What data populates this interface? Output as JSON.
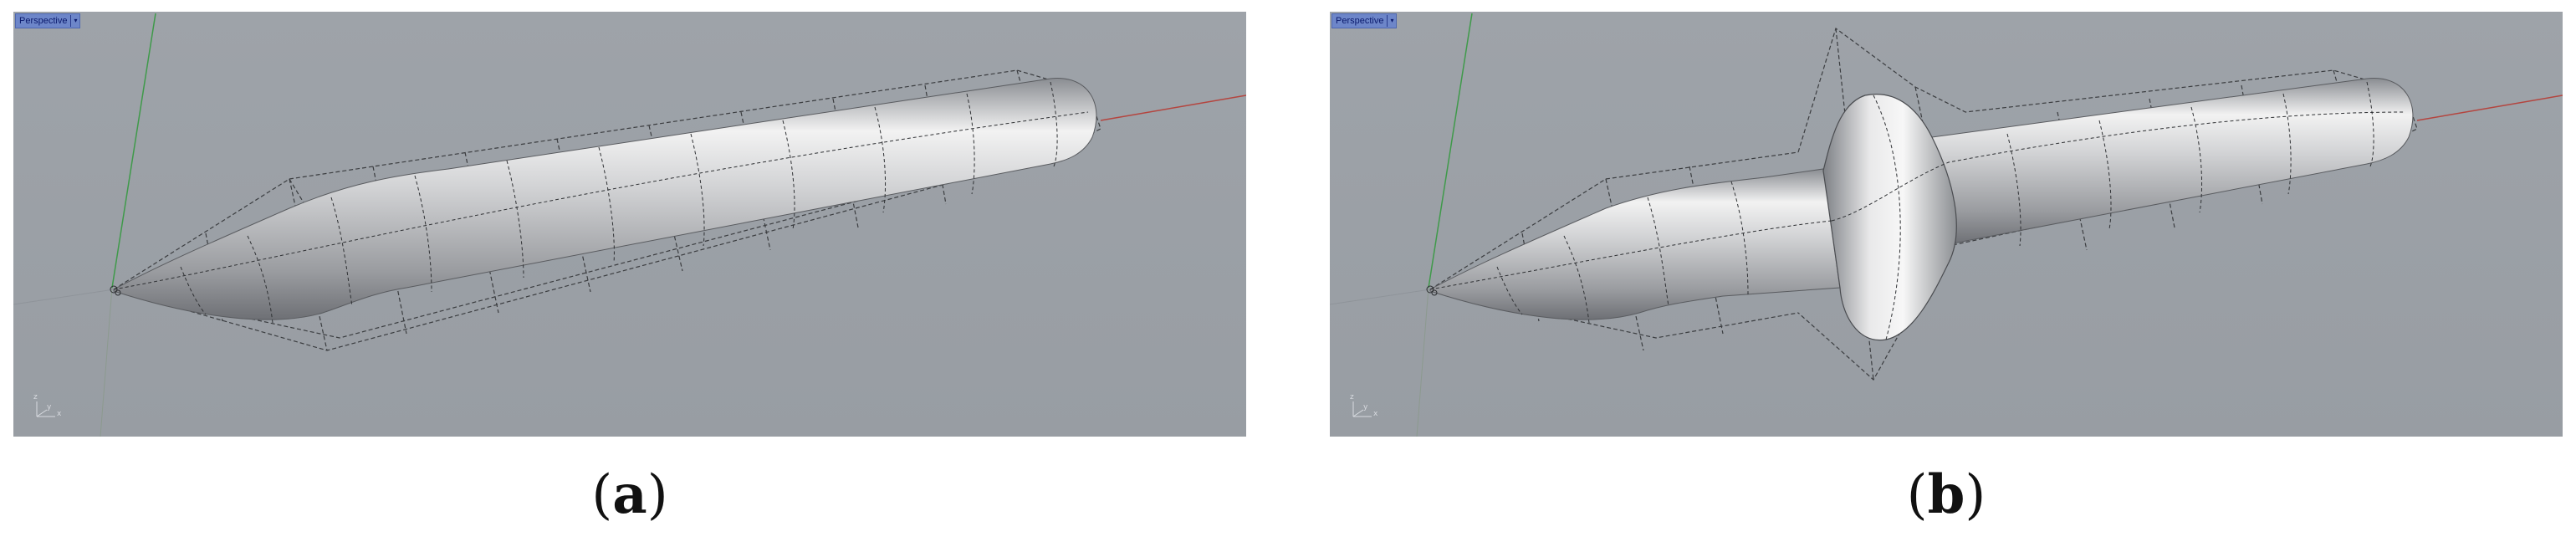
{
  "panels": [
    {
      "id": "a",
      "viewport_label": "Perspective",
      "dropdown_glyph": "▾",
      "axis_labels": {
        "z": "z",
        "y": "y",
        "x": "x"
      },
      "caption_open": "(",
      "caption_letter": "a",
      "caption_close": ")"
    },
    {
      "id": "b",
      "viewport_label": "Perspective",
      "dropdown_glyph": "▾",
      "axis_labels": {
        "z": "z",
        "y": "y",
        "x": "x"
      },
      "caption_open": "(",
      "caption_letter": "b",
      "caption_close": ")"
    }
  ],
  "colors": {
    "viewport_bg": "#9ea3a9",
    "label_bg": "#6d86c9",
    "x_axis": "#b4453f",
    "y_axis": "#3f9a4a",
    "control_cage": "#3b3d40",
    "surface_highlight": "#f4f4f4",
    "surface_shadow": "#6f7277"
  }
}
